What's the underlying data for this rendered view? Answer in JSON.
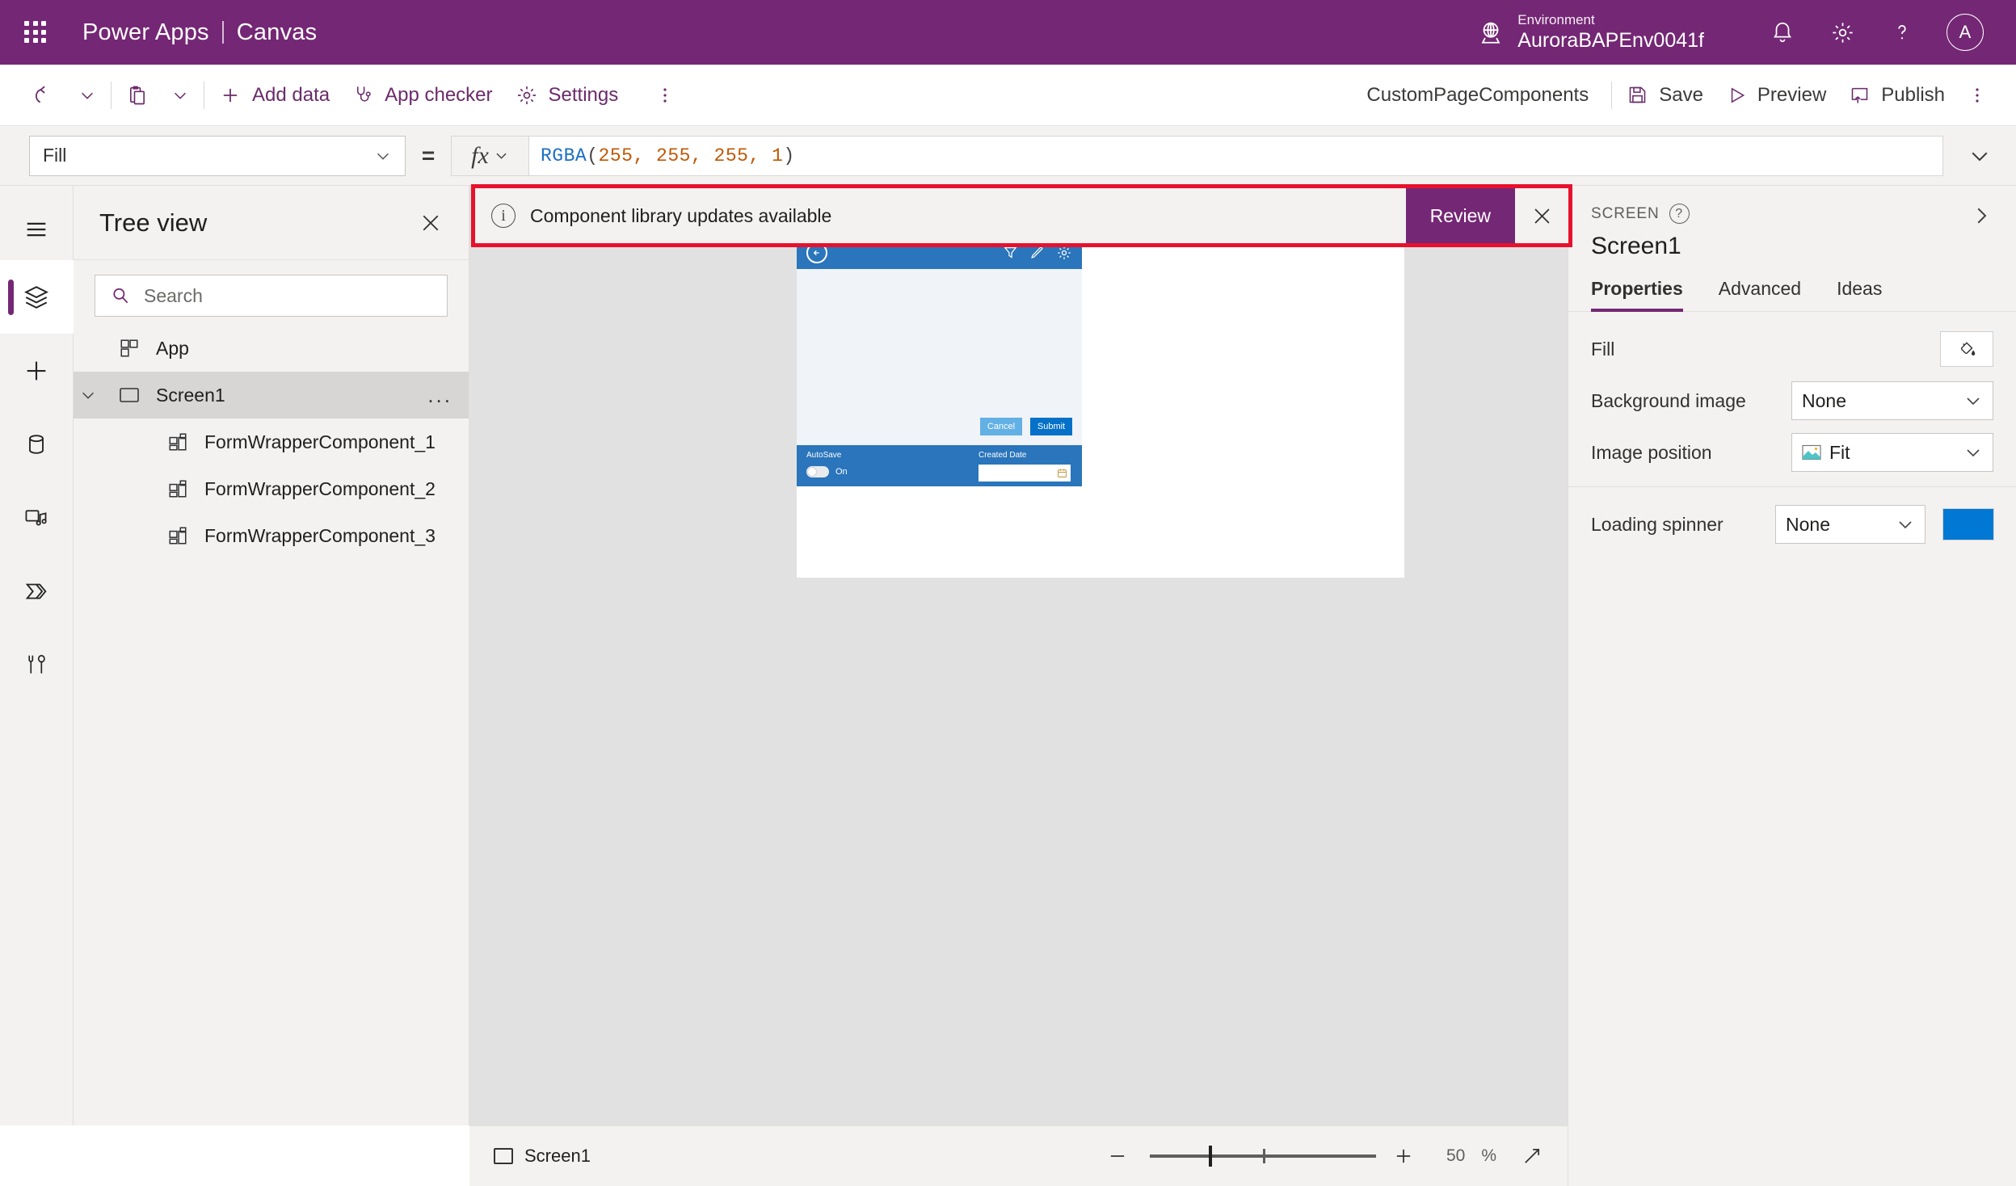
{
  "header": {
    "brand": "Power Apps",
    "separator": "|",
    "product": "Canvas",
    "environment_label": "Environment",
    "environment_name": "AuroraBAPEnv0041f",
    "avatar_initial": "A",
    "brand_color": "#742774",
    "icons": [
      "waffle-icon",
      "globe-icon",
      "bell-icon",
      "gear-icon",
      "help-icon",
      "avatar"
    ]
  },
  "commandbar": {
    "undo": "undo-icon",
    "undo_caret": "chevron-down-icon",
    "paste": "paste-icon",
    "paste_caret": "chevron-down-icon",
    "add_data": "Add data",
    "app_checker": "App checker",
    "settings": "Settings",
    "overflow": "more-icon",
    "app_name": "CustomPageComponents",
    "save": "Save",
    "preview": "Preview",
    "publish": "Publish",
    "right_overflow": "more-icon"
  },
  "formulabar": {
    "property": "Fill",
    "equals": "=",
    "fx_label": "fx",
    "formula_fn": "RGBA",
    "formula_open": "(",
    "formula_args": "255, 255, 255, 1",
    "formula_close": ")",
    "formula_full": "RGBA(255, 255, 255, 1)",
    "expand": "chevron-down-icon"
  },
  "rail": {
    "items": [
      {
        "name": "hamburger-icon",
        "label": "Menu",
        "active": false
      },
      {
        "name": "layers-icon",
        "label": "Tree view",
        "active": true
      },
      {
        "name": "plus-icon",
        "label": "Insert",
        "active": false
      },
      {
        "name": "database-icon",
        "label": "Data",
        "active": false
      },
      {
        "name": "media-icon",
        "label": "Media",
        "active": false
      },
      {
        "name": "power-automate-icon",
        "label": "Power Automate",
        "active": false
      },
      {
        "name": "tools-icon",
        "label": "Variables",
        "active": false
      }
    ]
  },
  "treeview": {
    "title": "Tree view",
    "close": "close-icon",
    "search_placeholder": "Search",
    "search_value": "",
    "nodes": [
      {
        "label": "App",
        "indent": 1,
        "icon": "app-icon",
        "selected": false,
        "caret": false
      },
      {
        "label": "Screen1",
        "indent": 0,
        "icon": "screen-icon",
        "selected": true,
        "caret": true,
        "overflow": "..."
      },
      {
        "label": "FormWrapperComponent_1",
        "indent": 2,
        "icon": "component-icon",
        "selected": false,
        "caret": false
      },
      {
        "label": "FormWrapperComponent_2",
        "indent": 2,
        "icon": "component-icon",
        "selected": false,
        "caret": false
      },
      {
        "label": "FormWrapperComponent_3",
        "indent": 2,
        "icon": "component-icon",
        "selected": false,
        "caret": false
      }
    ]
  },
  "banner": {
    "icon": "info-icon",
    "message": "Component library updates available",
    "review_label": "Review",
    "close": "close-icon",
    "border_color": "#e8112d",
    "button_color": "#742774"
  },
  "canvas": {
    "app_header_icons": [
      "back-arrow-icon",
      "filter-icon",
      "pencil-icon",
      "gear-icon"
    ],
    "header_color": "#2a75bb",
    "body_color": "#f0f3f7",
    "cancel_label": "Cancel",
    "submit_label": "Submit",
    "cancel_color": "#63b0e5",
    "submit_color": "#0571c8",
    "autosave_label": "AutoSave",
    "autosave_state": "On",
    "created_date_label": "Created Date",
    "created_date_value": "",
    "calendar_icon": "calendar-icon"
  },
  "properties": {
    "section_label": "SCREEN",
    "help_icon": "help-icon",
    "expand_icon": "chevron-right-icon",
    "control_name": "Screen1",
    "tabs": [
      {
        "label": "Properties",
        "active": true
      },
      {
        "label": "Advanced",
        "active": false
      },
      {
        "label": "Ideas",
        "active": false
      }
    ],
    "rows": [
      {
        "label": "Fill",
        "type": "color",
        "icon": "fill-bucket-icon"
      },
      {
        "label": "Background image",
        "type": "dropdown",
        "value": "None"
      },
      {
        "label": "Image position",
        "type": "dropdown",
        "value": "Fit",
        "icon": "image-icon"
      }
    ],
    "spinner": {
      "label": "Loading spinner",
      "value": "None",
      "color": "#0078d4"
    }
  },
  "statusbar": {
    "screen_label": "Screen1",
    "screen_icon": "screen-icon",
    "zoom_out": "minus-icon",
    "zoom_in": "plus-icon",
    "zoom_value": "50",
    "zoom_unit": "%",
    "fit_icon": "fit-screen-icon"
  }
}
